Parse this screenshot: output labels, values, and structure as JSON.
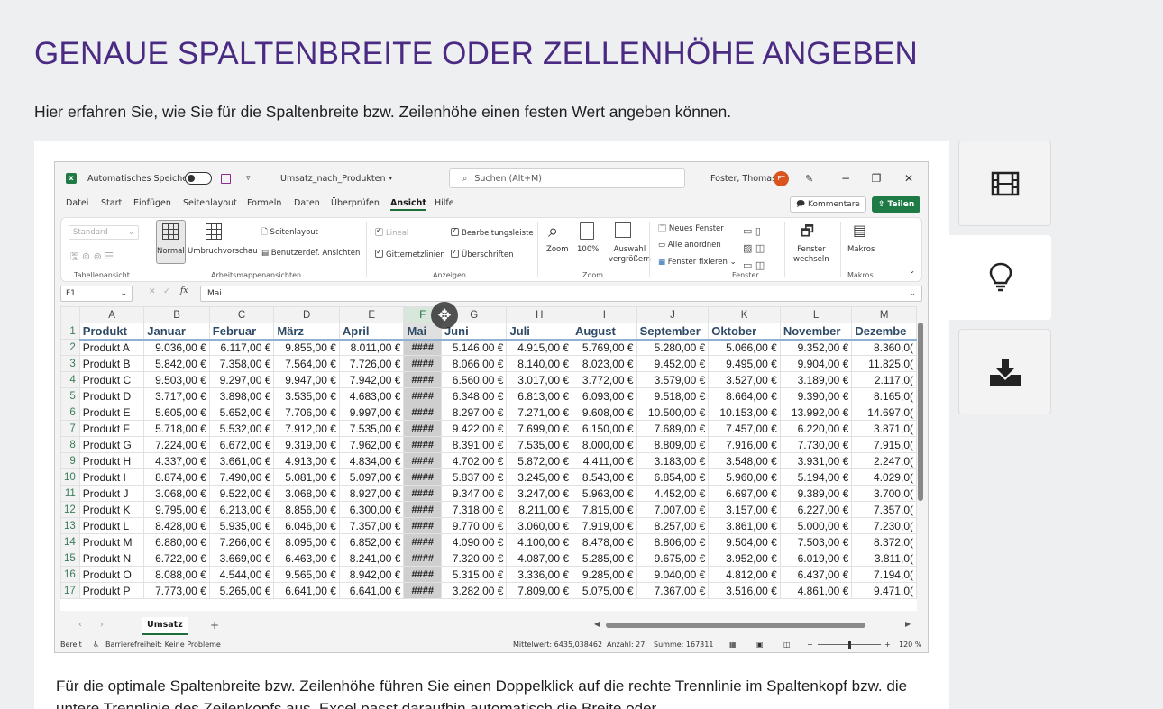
{
  "page": {
    "title": "GENAUE SPALTENBREITE ODER ZELLENHÖHE ANGEBEN",
    "intro": "Hier erfahren Sie, wie Sie für die Spaltenbreite bzw. Zeilenhöhe einen festen Wert angeben können.",
    "footer_text": "Für die optimale Spaltenbreite bzw. Zeilenhöhe führen Sie einen Doppelklick auf die rechte Trennlinie im Spaltenkopf bzw. die untere Trennlinie des Zeilenkopfs aus. Excel passt daraufhin automatisch die Breite oder"
  },
  "side_tabs": [
    {
      "icon": "film-icon",
      "glyph": "🎞"
    },
    {
      "icon": "lightbulb-icon",
      "glyph": "💡"
    },
    {
      "icon": "download-icon",
      "glyph": "⤓"
    }
  ],
  "excel": {
    "autosave_label": "Automatisches Speichern",
    "filename": "Umsatz_nach_Produkten",
    "search_placeholder": "Suchen (Alt+M)",
    "user_name": "Foster, Thomas",
    "user_initials": "FT",
    "menu": [
      "Datei",
      "Start",
      "Einfügen",
      "Seitenlayout",
      "Formeln",
      "Daten",
      "Überprüfen",
      "Ansicht",
      "Hilfe"
    ],
    "active_menu": "Ansicht",
    "kommentare_label": "Kommentare",
    "teilen_label": "Teilen",
    "ribbon": {
      "standard": "Standard",
      "normal": "Normal",
      "umbruch": "Umbruchvorschau",
      "seitenlayout": "Seitenlayout",
      "benutzerdef": "Benutzerdef. Ansichten",
      "lineal": "Lineal",
      "gitternetz": "Gitternetzlinien",
      "bearbeitungsleiste": "Bearbeitungsleiste",
      "ueberschriften": "Überschriften",
      "zoom": "Zoom",
      "hundert": "100%",
      "auswahl": "Auswahl",
      "vergroessern": "vergrößern",
      "neues_fenster": "Neues Fenster",
      "alle_anordnen": "Alle anordnen",
      "fenster_fixieren": "Fenster fixieren",
      "fenster": "Fenster",
      "wechseln": "wechseln",
      "makros": "Makros",
      "groups": {
        "tabellenansicht": "Tabellenansicht",
        "arbeitsmappenansichten": "Arbeitsmappenansichten",
        "anzeigen": "Anzeigen",
        "zoom": "Zoom",
        "fenster": "Fenster",
        "makros": "Makros"
      }
    },
    "namebox": "F1",
    "formula": "Mai",
    "columns": [
      "A",
      "B",
      "C",
      "D",
      "E",
      "F",
      "G",
      "H",
      "I",
      "J",
      "K",
      "L",
      "M"
    ],
    "header_row": [
      "Produkt",
      "Januar",
      "Februar",
      "März",
      "April",
      "Mai",
      "Juni",
      "Juli",
      "August",
      "September",
      "Oktober",
      "November",
      "Dezembe"
    ],
    "rows": [
      [
        "Produkt A",
        "9.036,00 €",
        "6.117,00 €",
        "9.855,00 €",
        "8.011,00 €",
        "####",
        "5.146,00 €",
        "4.915,00 €",
        "5.769,00 €",
        "5.280,00 €",
        "5.066,00 €",
        "9.352,00 €",
        "8.360,0("
      ],
      [
        "Produkt B",
        "5.842,00 €",
        "7.358,00 €",
        "7.564,00 €",
        "7.726,00 €",
        "####",
        "8.066,00 €",
        "8.140,00 €",
        "8.023,00 €",
        "9.452,00 €",
        "9.495,00 €",
        "9.904,00 €",
        "11.825,0("
      ],
      [
        "Produkt C",
        "9.503,00 €",
        "9.297,00 €",
        "9.947,00 €",
        "7.942,00 €",
        "####",
        "6.560,00 €",
        "3.017,00 €",
        "3.772,00 €",
        "3.579,00 €",
        "3.527,00 €",
        "3.189,00 €",
        "2.117,0("
      ],
      [
        "Produkt D",
        "3.717,00 €",
        "3.898,00 €",
        "3.535,00 €",
        "4.683,00 €",
        "####",
        "6.348,00 €",
        "6.813,00 €",
        "6.093,00 €",
        "9.518,00 €",
        "8.664,00 €",
        "9.390,00 €",
        "8.165,0("
      ],
      [
        "Produkt E",
        "5.605,00 €",
        "5.652,00 €",
        "7.706,00 €",
        "9.997,00 €",
        "####",
        "8.297,00 €",
        "7.271,00 €",
        "9.608,00 €",
        "10.500,00 €",
        "10.153,00 €",
        "13.992,00 €",
        "14.697,0("
      ],
      [
        "Produkt F",
        "5.718,00 €",
        "5.532,00 €",
        "7.912,00 €",
        "7.535,00 €",
        "####",
        "9.422,00 €",
        "7.699,00 €",
        "6.150,00 €",
        "7.689,00 €",
        "7.457,00 €",
        "6.220,00 €",
        "3.871,0("
      ],
      [
        "Produkt G",
        "7.224,00 €",
        "6.672,00 €",
        "9.319,00 €",
        "7.962,00 €",
        "####",
        "8.391,00 €",
        "7.535,00 €",
        "8.000,00 €",
        "8.809,00 €",
        "7.916,00 €",
        "7.730,00 €",
        "7.915,0("
      ],
      [
        "Produkt H",
        "4.337,00 €",
        "3.661,00 €",
        "4.913,00 €",
        "4.834,00 €",
        "####",
        "4.702,00 €",
        "5.872,00 €",
        "4.411,00 €",
        "3.183,00 €",
        "3.548,00 €",
        "3.931,00 €",
        "2.247,0("
      ],
      [
        "Produkt I",
        "8.874,00 €",
        "7.490,00 €",
        "5.081,00 €",
        "5.097,00 €",
        "####",
        "5.837,00 €",
        "3.245,00 €",
        "8.543,00 €",
        "6.854,00 €",
        "5.960,00 €",
        "5.194,00 €",
        "4.029,0("
      ],
      [
        "Produkt J",
        "3.068,00 €",
        "9.522,00 €",
        "3.068,00 €",
        "8.927,00 €",
        "####",
        "9.347,00 €",
        "3.247,00 €",
        "5.963,00 €",
        "4.452,00 €",
        "6.697,00 €",
        "9.389,00 €",
        "3.700,0("
      ],
      [
        "Produkt K",
        "9.795,00 €",
        "6.213,00 €",
        "8.856,00 €",
        "6.300,00 €",
        "####",
        "7.318,00 €",
        "8.211,00 €",
        "7.815,00 €",
        "7.007,00 €",
        "3.157,00 €",
        "6.227,00 €",
        "7.357,0("
      ],
      [
        "Produkt L",
        "8.428,00 €",
        "5.935,00 €",
        "6.046,00 €",
        "7.357,00 €",
        "####",
        "9.770,00 €",
        "3.060,00 €",
        "7.919,00 €",
        "8.257,00 €",
        "3.861,00 €",
        "5.000,00 €",
        "7.230,0("
      ],
      [
        "Produkt M",
        "6.880,00 €",
        "7.266,00 €",
        "8.095,00 €",
        "6.852,00 €",
        "####",
        "4.090,00 €",
        "4.100,00 €",
        "8.478,00 €",
        "8.806,00 €",
        "9.504,00 €",
        "7.503,00 €",
        "8.372,0("
      ],
      [
        "Produkt N",
        "6.722,00 €",
        "3.669,00 €",
        "6.463,00 €",
        "8.241,00 €",
        "####",
        "7.320,00 €",
        "4.087,00 €",
        "5.285,00 €",
        "9.675,00 €",
        "3.952,00 €",
        "6.019,00 €",
        "3.811,0("
      ],
      [
        "Produkt O",
        "8.088,00 €",
        "4.544,00 €",
        "9.565,00 €",
        "8.942,00 €",
        "####",
        "5.315,00 €",
        "3.336,00 €",
        "9.285,00 €",
        "9.040,00 €",
        "4.812,00 €",
        "6.437,00 €",
        "7.194,0("
      ],
      [
        "Produkt P",
        "7.773,00 €",
        "5.265,00 €",
        "6.641,00 €",
        "6.641,00 €",
        "####",
        "3.282,00 €",
        "7.809,00 €",
        "5.075,00 €",
        "7.367,00 €",
        "3.516,00 €",
        "4.861,00 €",
        "9.471,0("
      ]
    ],
    "sheet_tab": "Umsatz",
    "status": {
      "ready": "Bereit",
      "accessibility": "Barrierefreiheit: Keine Probleme",
      "mittelwert": "Mittelwert: 6435,038462",
      "anzahl": "Anzahl: 27",
      "summe": "Summe: 167311",
      "zoom": "120 %"
    }
  }
}
